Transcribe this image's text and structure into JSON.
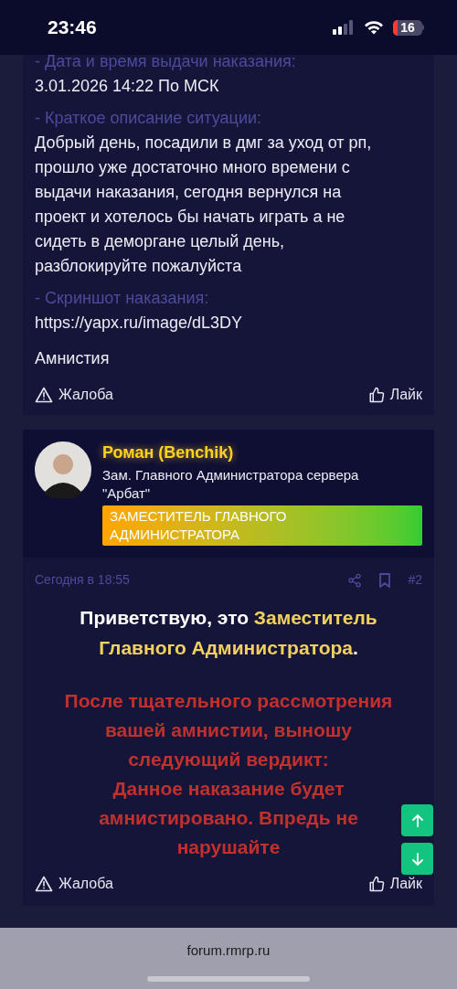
{
  "status_bar": {
    "time": "23:46",
    "battery": "16"
  },
  "previous_post": {
    "fields": [
      {
        "label": "- Дата и время выдачи наказания:",
        "value": "3.01.2026 14:22 По МСК"
      },
      {
        "label": "- Краткое описание ситуации:",
        "value": "Добрый день, посадили в дмг за уход от рп, прошло уже достаточно много времени с выдачи наказания, сегодня вернулся на проект и хотелось бы начать играть а не сидеть в деморгане целый день, разблокируйте пожалуйста"
      },
      {
        "label": "- Скриншот наказания:",
        "value": "https://yapx.ru/image/dL3DY"
      }
    ],
    "closing": "Амнистия",
    "actions": {
      "report": "Жалоба",
      "like": "Лайк"
    }
  },
  "post": {
    "author": {
      "name": "Роман (Benchik)",
      "title": "Зам. Главного Администратора сервера \"Арбат\"",
      "badge": "ЗАМЕСТИТЕЛЬ ГЛАВНОГО АДМИНИСТРАТОРА"
    },
    "date": "Сегодня в 18:55",
    "number": "#2",
    "greeting": [
      {
        "text": "Приветствую, это ",
        "highlight": false
      },
      {
        "text": "Заместитель Главного Администратора",
        "highlight": true
      },
      {
        "text": ".",
        "highlight": false
      }
    ],
    "verdict": [
      "После тщательного рассмотрения вашей амнистии, выношу следующий вердикт:",
      "Данное наказание будет амнистировано. Впредь не нарушайте"
    ],
    "actions": {
      "report": "Жалоба",
      "like": "Лайк"
    }
  },
  "browser": {
    "address": "forum.rmrp.ru"
  }
}
